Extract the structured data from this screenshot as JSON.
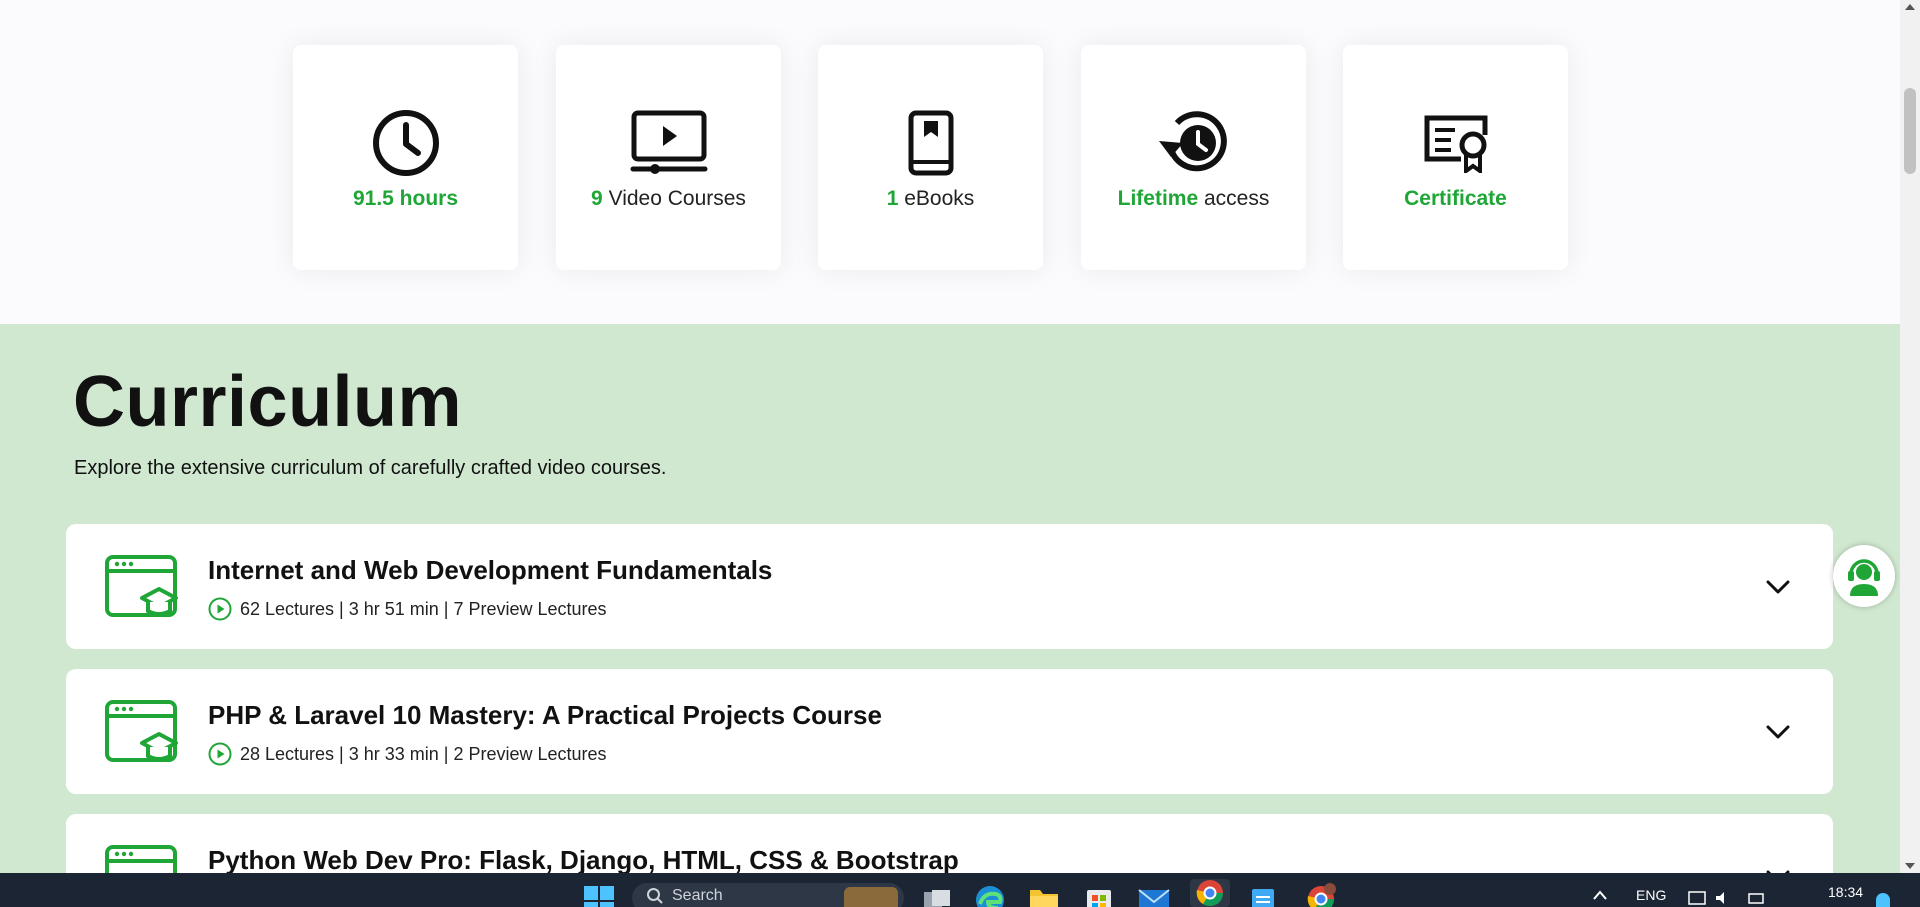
{
  "features": [
    {
      "highlight": "91.5 hours",
      "text": "",
      "icon": "clock-icon"
    },
    {
      "highlight": "9",
      "text": " Video Courses",
      "icon": "video-player-icon"
    },
    {
      "highlight": "1",
      "text": " eBooks",
      "icon": "tablet-book-icon"
    },
    {
      "highlight": "Lifetime",
      "text": " access",
      "icon": "history-clock-icon"
    },
    {
      "highlight": "Certificate",
      "text": "",
      "icon": "certificate-icon"
    }
  ],
  "curriculum": {
    "title": "Curriculum",
    "subtitle": "Explore the extensive curriculum of carefully crafted video courses.",
    "courses": [
      {
        "title": "Internet and Web Development Fundamentals",
        "meta": "62 Lectures | 3 hr 51 min | 7 Preview Lectures"
      },
      {
        "title": "PHP & Laravel 10 Mastery: A Practical Projects Course",
        "meta": "28 Lectures | 3 hr 33 min | 2 Preview Lectures"
      },
      {
        "title": "Python Web Dev Pro: Flask, Django, HTML, CSS & Bootstrap",
        "meta": ""
      }
    ]
  },
  "taskbar": {
    "search_placeholder": "Search",
    "language": "ENG",
    "time": "18:34"
  },
  "colors": {
    "accent_green": "#1fa637",
    "section_bg": "#d0e8d0",
    "taskbar_bg": "#1c2534"
  }
}
